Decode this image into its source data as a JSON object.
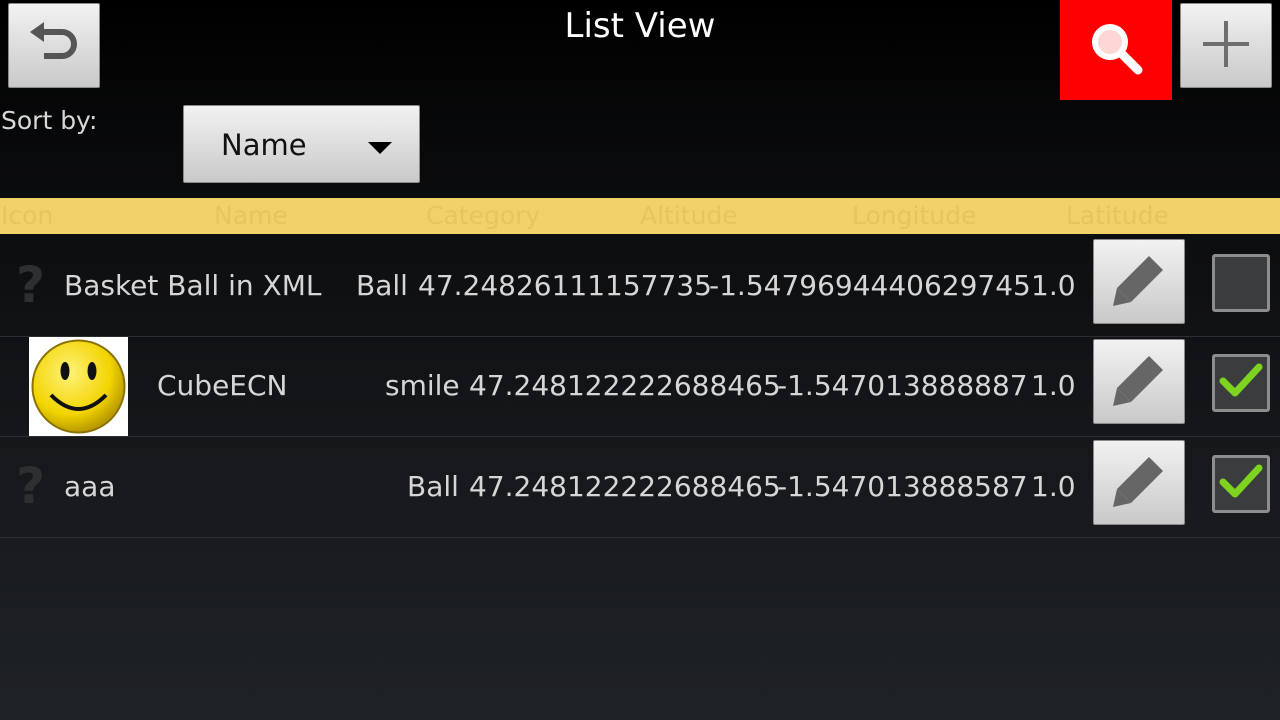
{
  "header": {
    "title": "List View",
    "icons": {
      "back": "undo-icon",
      "search": "search-icon",
      "add": "plus-icon"
    },
    "search_button_color": "#ff0000"
  },
  "sort": {
    "label": "Sort by:",
    "selected": "Name"
  },
  "columns": [
    "Icon",
    "Name",
    "Category",
    "Altitude",
    "Longitude",
    "Latitude"
  ],
  "rows": [
    {
      "icon": "question-mark-icon",
      "name": "Basket Ball in XML",
      "category": "Ball",
      "altitude": "47.24826111157735",
      "longitude": "-1.5479694440629745",
      "latitude": "1.0",
      "checked": false,
      "question": "?"
    },
    {
      "icon": "smiley-face-icon",
      "name": "CubeECN",
      "category": "smile",
      "altitude": "47.248122222688465",
      "longitude": "-1.547013888887",
      "latitude": "1.0",
      "checked": true
    },
    {
      "icon": "question-mark-icon",
      "name": "aaa",
      "category": "Ball",
      "altitude": "47.248122222688465",
      "longitude": "-1.547013888587",
      "latitude": "1.0",
      "checked": true,
      "question": "?"
    }
  ],
  "colors": {
    "header_bar": "#f2d16b",
    "check": "#7ed321"
  }
}
